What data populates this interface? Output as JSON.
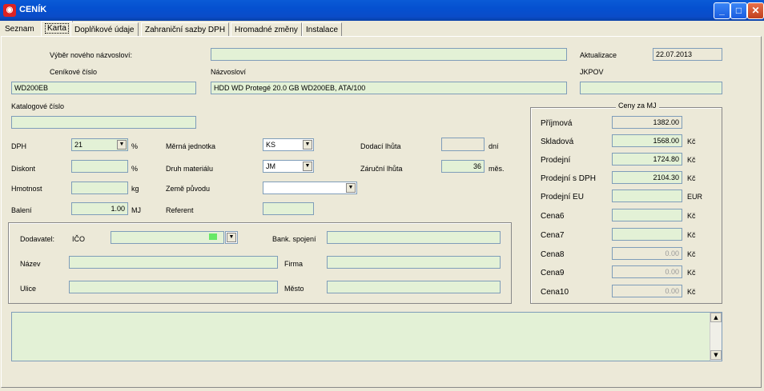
{
  "window": {
    "title": "CENÍK",
    "app_icon": "app-logo-icon",
    "buttons": {
      "minimize": "_",
      "maximize": "□",
      "close": "✕"
    }
  },
  "tabs": [
    "Seznam",
    "Karta",
    "Doplňkové údaje",
    "Zahraniční sazby DPH",
    "Hromadné změny",
    "Instalace"
  ],
  "active_tab": "Karta",
  "form": {
    "vyber_label": "Výběr nového názvosloví:",
    "vyber_value": "",
    "aktualizace_label": "Aktualizace",
    "aktualizace_value": "22.07.2013",
    "cenikove_cislo_label": "Ceníkové číslo",
    "cenikove_cislo_value": "WD200EB",
    "nazvoslovi_label": "Názvosloví",
    "nazvoslovi_value": "HDD WD Protegé 20.0 GB  WD200EB, ATA/100",
    "jkpov_label": "JKPOV",
    "jkpov_value": "",
    "katalogove_label": "Katalogové číslo",
    "katalogove_value": "",
    "dph_label": "DPH",
    "dph_value": "21",
    "dph_unit": "%",
    "diskont_label": "Diskont",
    "diskont_value": "",
    "diskont_unit": "%",
    "hmotnost_label": "Hmotnost",
    "hmotnost_value": "",
    "hmotnost_unit": "kg",
    "baleni_label": "Balení",
    "baleni_value": "1.00",
    "baleni_unit": "MJ",
    "merna_label": "Měrná jednotka",
    "merna_value": "KS",
    "druh_label": "Druh materiálu",
    "druh_value": "JM",
    "zeme_label": "Země původu",
    "zeme_value": "",
    "referent_label": "Referent",
    "referent_value": "",
    "dodaci_label": "Dodací lhůta",
    "dodaci_value": "",
    "dodaci_unit": "dní",
    "zarucni_label": "Záruční lhůta",
    "zarucni_value": "36",
    "zarucni_unit": "měs."
  },
  "supplier": {
    "dodavatel_label": "Dodavatel:",
    "ico_label": "IČO",
    "ico_value": "",
    "bank_label": "Bank. spojení",
    "bank_value": "",
    "nazev_label": "Název",
    "nazev_value": "",
    "firma_label": "Firma",
    "firma_value": "",
    "ulice_label": "Ulice",
    "ulice_value": "",
    "mesto_label": "Město",
    "mesto_value": ""
  },
  "prices": {
    "group_title": "Ceny za MJ",
    "rows": [
      {
        "label": "Příjmová",
        "value": "1382.00",
        "unit": ""
      },
      {
        "label": "Skladová",
        "value": "1568.00",
        "unit": "Kč"
      },
      {
        "label": "Prodejní",
        "value": "1724.80",
        "unit": "Kč"
      },
      {
        "label": "Prodejní s DPH",
        "value": "2104.30",
        "unit": "Kč"
      },
      {
        "label": "Prodejní EU",
        "value": "",
        "unit": "EUR"
      },
      {
        "label": "Cena6",
        "value": "",
        "unit": "Kč"
      },
      {
        "label": "Cena7",
        "value": "",
        "unit": "Kč"
      },
      {
        "label": "Cena8",
        "value": "0.00",
        "unit": "Kč"
      },
      {
        "label": "Cena9",
        "value": "0.00",
        "unit": "Kč"
      },
      {
        "label": "Cena10",
        "value": "0.00",
        "unit": "Kč"
      }
    ]
  },
  "memo": {
    "value": ""
  }
}
